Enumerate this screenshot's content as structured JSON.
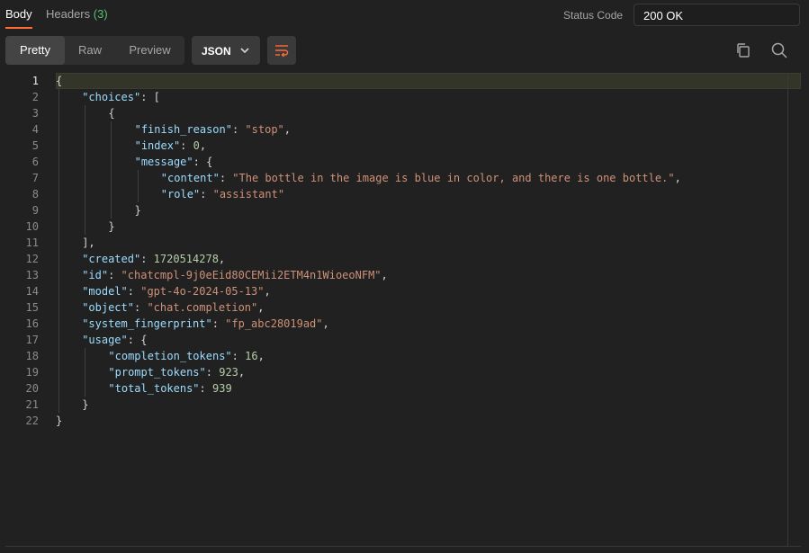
{
  "tabs": {
    "body_label": "Body",
    "headers_label": "Headers",
    "headers_count": "(3)"
  },
  "status": {
    "label": "Status Code",
    "value": "200 OK"
  },
  "toolbar": {
    "pretty_label": "Pretty",
    "raw_label": "Raw",
    "preview_label": "Preview",
    "format_label": "JSON",
    "icons": [
      "wrap-lines-icon",
      "copy-icon",
      "search-icon"
    ]
  },
  "colors": {
    "accent": "#ff6c37",
    "key": "#9cdcfe",
    "string": "#ce9178",
    "number": "#b5cea8",
    "success": "#56c271"
  },
  "code_lines": [
    {
      "num": "1",
      "indent": 0,
      "tokens": [
        {
          "t": "p",
          "v": "{"
        }
      ]
    },
    {
      "num": "2",
      "indent": 1,
      "tokens": [
        {
          "t": "k",
          "v": "\"choices\""
        },
        {
          "t": "p",
          "v": ": ["
        }
      ]
    },
    {
      "num": "3",
      "indent": 2,
      "tokens": [
        {
          "t": "p",
          "v": "{"
        }
      ]
    },
    {
      "num": "4",
      "indent": 3,
      "tokens": [
        {
          "t": "k",
          "v": "\"finish_reason\""
        },
        {
          "t": "p",
          "v": ": "
        },
        {
          "t": "s",
          "v": "\"stop\""
        },
        {
          "t": "p",
          "v": ","
        }
      ]
    },
    {
      "num": "5",
      "indent": 3,
      "tokens": [
        {
          "t": "k",
          "v": "\"index\""
        },
        {
          "t": "p",
          "v": ": "
        },
        {
          "t": "n",
          "v": "0"
        },
        {
          "t": "p",
          "v": ","
        }
      ]
    },
    {
      "num": "6",
      "indent": 3,
      "tokens": [
        {
          "t": "k",
          "v": "\"message\""
        },
        {
          "t": "p",
          "v": ": {"
        }
      ]
    },
    {
      "num": "7",
      "indent": 4,
      "tokens": [
        {
          "t": "k",
          "v": "\"content\""
        },
        {
          "t": "p",
          "v": ": "
        },
        {
          "t": "s",
          "v": "\"The bottle in the image is blue in color, and there is one bottle.\""
        },
        {
          "t": "p",
          "v": ","
        }
      ]
    },
    {
      "num": "8",
      "indent": 4,
      "tokens": [
        {
          "t": "k",
          "v": "\"role\""
        },
        {
          "t": "p",
          "v": ": "
        },
        {
          "t": "s",
          "v": "\"assistant\""
        }
      ]
    },
    {
      "num": "9",
      "indent": 3,
      "tokens": [
        {
          "t": "p",
          "v": "}"
        }
      ]
    },
    {
      "num": "10",
      "indent": 2,
      "tokens": [
        {
          "t": "p",
          "v": "}"
        }
      ]
    },
    {
      "num": "11",
      "indent": 1,
      "tokens": [
        {
          "t": "p",
          "v": "],"
        }
      ]
    },
    {
      "num": "12",
      "indent": 1,
      "tokens": [
        {
          "t": "k",
          "v": "\"created\""
        },
        {
          "t": "p",
          "v": ": "
        },
        {
          "t": "n",
          "v": "1720514278"
        },
        {
          "t": "p",
          "v": ","
        }
      ]
    },
    {
      "num": "13",
      "indent": 1,
      "tokens": [
        {
          "t": "k",
          "v": "\"id\""
        },
        {
          "t": "p",
          "v": ": "
        },
        {
          "t": "s",
          "v": "\"chatcmpl-9j0eEid80CEMii2ETM4n1WioeoNFM\""
        },
        {
          "t": "p",
          "v": ","
        }
      ]
    },
    {
      "num": "14",
      "indent": 1,
      "tokens": [
        {
          "t": "k",
          "v": "\"model\""
        },
        {
          "t": "p",
          "v": ": "
        },
        {
          "t": "s",
          "v": "\"gpt-4o-2024-05-13\""
        },
        {
          "t": "p",
          "v": ","
        }
      ]
    },
    {
      "num": "15",
      "indent": 1,
      "tokens": [
        {
          "t": "k",
          "v": "\"object\""
        },
        {
          "t": "p",
          "v": ": "
        },
        {
          "t": "s",
          "v": "\"chat.completion\""
        },
        {
          "t": "p",
          "v": ","
        }
      ]
    },
    {
      "num": "16",
      "indent": 1,
      "tokens": [
        {
          "t": "k",
          "v": "\"system_fingerprint\""
        },
        {
          "t": "p",
          "v": ": "
        },
        {
          "t": "s",
          "v": "\"fp_abc28019ad\""
        },
        {
          "t": "p",
          "v": ","
        }
      ]
    },
    {
      "num": "17",
      "indent": 1,
      "tokens": [
        {
          "t": "k",
          "v": "\"usage\""
        },
        {
          "t": "p",
          "v": ": {"
        }
      ]
    },
    {
      "num": "18",
      "indent": 2,
      "tokens": [
        {
          "t": "k",
          "v": "\"completion_tokens\""
        },
        {
          "t": "p",
          "v": ": "
        },
        {
          "t": "n",
          "v": "16"
        },
        {
          "t": "p",
          "v": ","
        }
      ]
    },
    {
      "num": "19",
      "indent": 2,
      "tokens": [
        {
          "t": "k",
          "v": "\"prompt_tokens\""
        },
        {
          "t": "p",
          "v": ": "
        },
        {
          "t": "n",
          "v": "923"
        },
        {
          "t": "p",
          "v": ","
        }
      ]
    },
    {
      "num": "20",
      "indent": 2,
      "tokens": [
        {
          "t": "k",
          "v": "\"total_tokens\""
        },
        {
          "t": "p",
          "v": ": "
        },
        {
          "t": "n",
          "v": "939"
        }
      ]
    },
    {
      "num": "21",
      "indent": 1,
      "tokens": [
        {
          "t": "p",
          "v": "}"
        }
      ]
    },
    {
      "num": "22",
      "indent": 0,
      "tokens": [
        {
          "t": "p",
          "v": "}"
        }
      ]
    }
  ]
}
